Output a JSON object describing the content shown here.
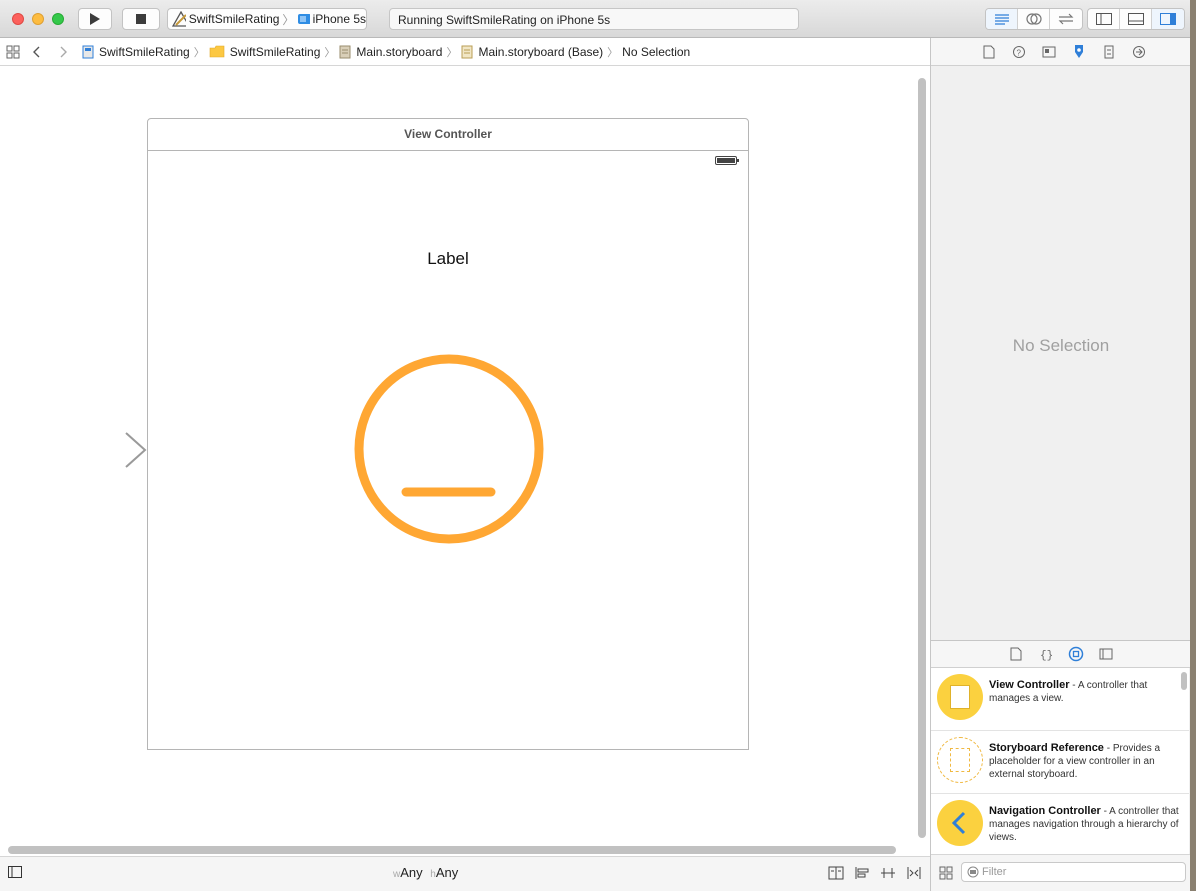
{
  "window": {
    "scheme_project": "SwiftSmileRating",
    "scheme_device": "iPhone 5s",
    "activity_status": "Running SwiftSmileRating on iPhone 5s"
  },
  "jumpbar": {
    "items": [
      "SwiftSmileRating",
      "SwiftSmileRating",
      "Main.storyboard",
      "Main.storyboard (Base)",
      "No Selection"
    ]
  },
  "canvas": {
    "scene_title": "View Controller",
    "label_text": "Label",
    "smile_color": "#FFA733"
  },
  "bottom_bar": {
    "w_prefix": "w",
    "w_value": "Any",
    "h_prefix": "h",
    "h_value": "Any"
  },
  "inspector": {
    "empty_text": "No Selection"
  },
  "library": {
    "items": [
      {
        "title": "View Controller",
        "desc": " - A controller that manages a view."
      },
      {
        "title": "Storyboard Reference",
        "desc": " - Provides a placeholder for a view controller in an external storyboard."
      },
      {
        "title": "Navigation Controller",
        "desc": " - A controller that manages navigation through a hierarchy of views."
      }
    ],
    "filter_placeholder": "Filter"
  },
  "icons": [
    "play-icon",
    "stop-icon",
    "xcode-app-icon",
    "device-icon",
    "grid-icon",
    "back-chevron-icon",
    "forward-chevron-icon",
    "folder-icon",
    "storyboard-file-icon",
    "standard-editor-icon",
    "assistant-editor-icon",
    "version-editor-icon",
    "navigator-toggle-icon",
    "debug-toggle-icon",
    "utilities-toggle-icon",
    "file-inspector-icon",
    "help-icon",
    "identity-icon",
    "attributes-icon",
    "size-icon",
    "connections-icon",
    "file-template-icon",
    "code-snippet-icon",
    "object-library-icon",
    "media-library-icon",
    "battery-icon",
    "entry-arrow-icon"
  ]
}
